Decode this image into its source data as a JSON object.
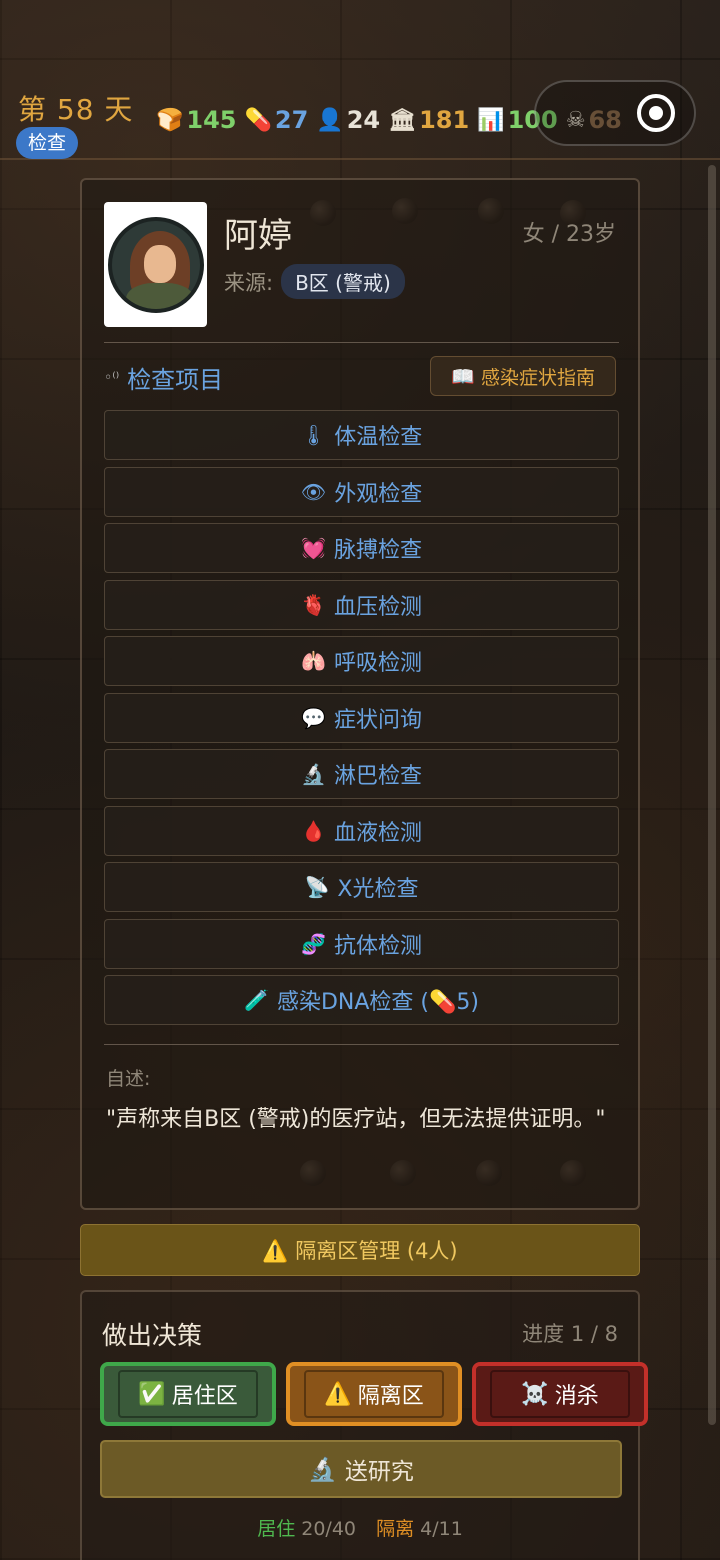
{
  "header": {
    "day_label": "第 58 天",
    "phase": "检查",
    "stats": [
      {
        "icon": "bread-icon",
        "glyph": "🍞",
        "value": "145",
        "color": "#7fd06a"
      },
      {
        "icon": "pill-icon",
        "glyph": "💊",
        "value": "27",
        "color": "#6aa3e0"
      },
      {
        "icon": "people-icon",
        "glyph": "👤",
        "value": "24",
        "color": "#e8e3d8"
      },
      {
        "icon": "building-icon",
        "glyph": "🏛",
        "value": "181",
        "color": "#e0a640"
      },
      {
        "icon": "chart-icon",
        "glyph": "📊",
        "value": "100",
        "color": "#7fd06a"
      },
      {
        "icon": "skull-icon",
        "glyph": "☠",
        "value": "68",
        "color": "#8a6a4a"
      }
    ]
  },
  "person": {
    "name": "阿婷",
    "gender_age": "女 / 23岁",
    "origin_label": "来源:",
    "origin_value": "B区 (警戒)"
  },
  "inspection": {
    "title": "检查项目",
    "guide_button": "感染症状指南",
    "items": [
      {
        "icon": "thermometer-icon",
        "glyph": "🌡",
        "label": "体温检查"
      },
      {
        "icon": "eye-icon",
        "glyph": "👁",
        "label": "外观检查"
      },
      {
        "icon": "heart-icon",
        "glyph": "💓",
        "label": "脉搏检查"
      },
      {
        "icon": "anatomical-heart-icon",
        "glyph": "🫀",
        "label": "血压检测"
      },
      {
        "icon": "lungs-icon",
        "glyph": "🫁",
        "label": "呼吸检测"
      },
      {
        "icon": "speech-bubble-icon",
        "glyph": "💬",
        "label": "症状问询"
      },
      {
        "icon": "microscope-icon",
        "glyph": "🔬",
        "label": "淋巴检查"
      },
      {
        "icon": "blood-drop-icon",
        "glyph": "🩸",
        "label": "血液检测"
      },
      {
        "icon": "satellite-dish-icon",
        "glyph": "📡",
        "label": "X光检查"
      },
      {
        "icon": "dna-icon",
        "glyph": "🧬",
        "label": "抗体检测"
      },
      {
        "icon": "test-tube-icon",
        "glyph": "🧪",
        "label": "感染DNA检查 (💊5)"
      }
    ]
  },
  "statement": {
    "label": "自述:",
    "text": "\"声称来自B区 (警戒)的医疗站，但无法提供证明。\""
  },
  "quarantine_bar": {
    "label": "⚠️ 隔离区管理 (4人)"
  },
  "decision": {
    "title": "做出决策",
    "progress": "进度 1 / 8",
    "buttons": [
      {
        "glyph": "✅",
        "label": "居住区"
      },
      {
        "glyph": "⚠️",
        "label": "隔离区"
      },
      {
        "glyph": "☠️",
        "label": "消杀"
      }
    ],
    "research_button": {
      "glyph": "🔬",
      "label": "送研究"
    },
    "capacity": {
      "resident_key": "居住",
      "resident_value": "20/40",
      "quarantine_key": "隔离",
      "quarantine_value": "4/11"
    }
  }
}
